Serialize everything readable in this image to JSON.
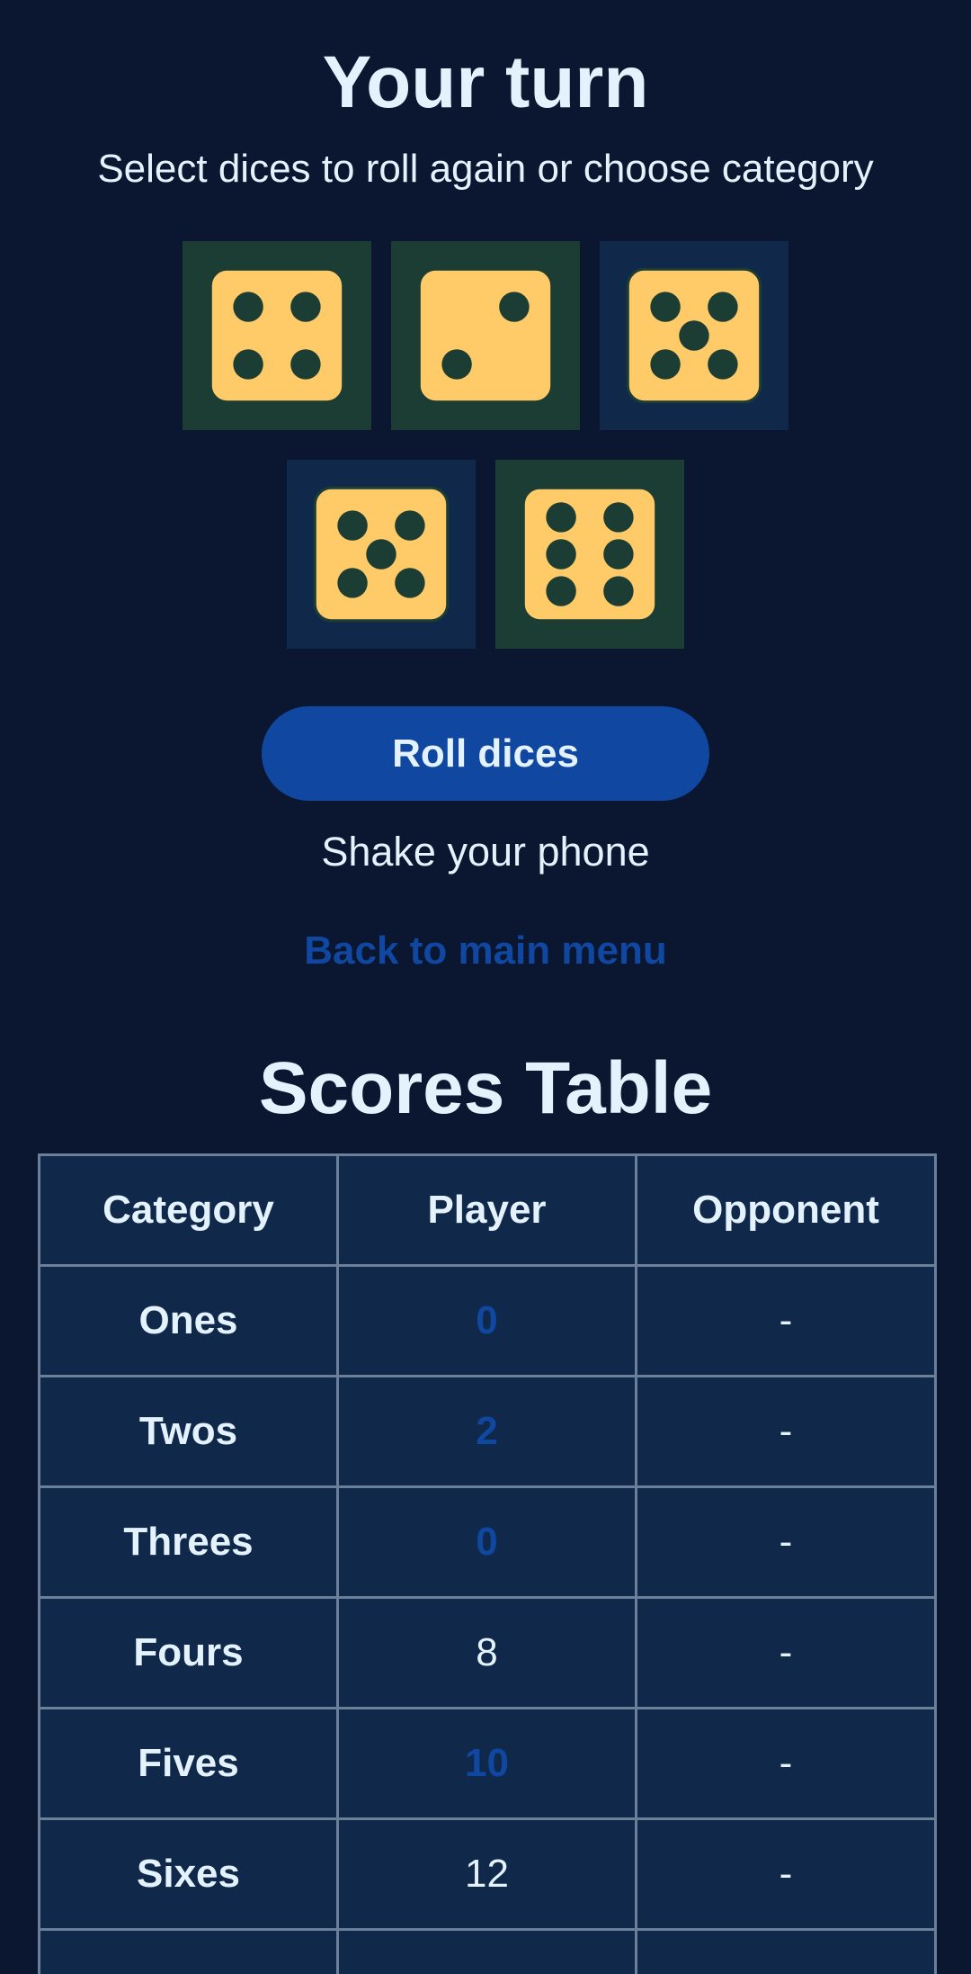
{
  "header": {
    "title": "Your turn",
    "subtitle": "Select dices to roll again or choose category"
  },
  "dice": [
    {
      "value": 4,
      "kept": true
    },
    {
      "value": 2,
      "kept": true
    },
    {
      "value": 5,
      "kept": false
    },
    {
      "value": 5,
      "kept": false
    },
    {
      "value": 6,
      "kept": true
    }
  ],
  "actions": {
    "roll_label": "Roll dices",
    "shake_hint": "Shake your phone",
    "back_label": "Back to main menu"
  },
  "scores": {
    "title": "Scores Table",
    "headers": [
      "Category",
      "Player",
      "Opponent"
    ],
    "rows": [
      {
        "category": "Ones",
        "player": "0",
        "opponent": "-",
        "potential": true
      },
      {
        "category": "Twos",
        "player": "2",
        "opponent": "-",
        "potential": true
      },
      {
        "category": "Threes",
        "player": "0",
        "opponent": "-",
        "potential": true
      },
      {
        "category": "Fours",
        "player": "8",
        "opponent": "-",
        "potential": false
      },
      {
        "category": "Fives",
        "player": "10",
        "opponent": "-",
        "potential": true
      },
      {
        "category": "Sixes",
        "player": "12",
        "opponent": "-",
        "potential": false
      },
      {
        "category": "",
        "player": "",
        "opponent": "",
        "potential": false
      }
    ]
  },
  "colors": {
    "background": "#0b1730",
    "kept_slot": "#1c3d33",
    "roll_slot": "#10294a",
    "die_face": "#ffcb69",
    "pip": "#1c3d33",
    "accent": "#0f47a1",
    "text": "#e3f2fd"
  }
}
